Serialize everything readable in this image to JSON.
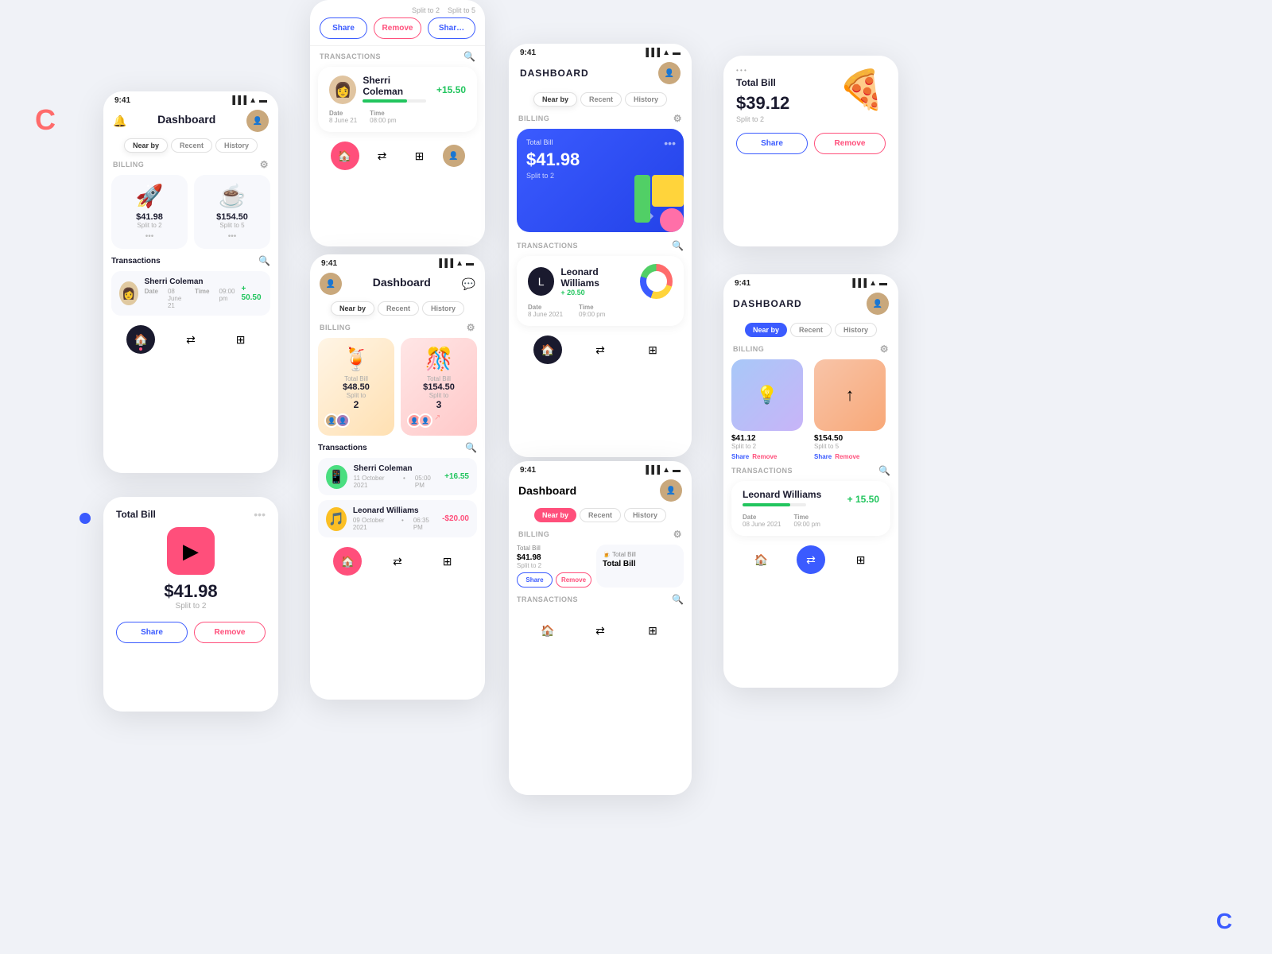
{
  "brand": {
    "logo": "C",
    "logo_color": "#ff6b6b"
  },
  "decorative": {
    "dot1_color": "#3b5bff",
    "dot2_color": "#3b5bff"
  },
  "phone1": {
    "time": "9:41",
    "title": "Dashboard",
    "tabs": [
      "Near by",
      "Recent",
      "History"
    ],
    "active_tab": "Near by",
    "billing_label": "Billing",
    "bills": [
      {
        "emoji": "🚀",
        "amount": "$41.98",
        "split": "Split to 2"
      },
      {
        "emoji": "☕",
        "amount": "$154.50",
        "split": "Split to 5"
      }
    ],
    "transactions_label": "Transactions",
    "txn_name": "Sherri Coleman",
    "txn_date_label": "Date",
    "txn_date": "08 June 21",
    "txn_time_label": "Time",
    "txn_time": "09:00 pm",
    "txn_amount": "+ 50.50"
  },
  "phone2": {
    "title": "Total Bill",
    "amount": "$41.98",
    "split": "Split to 2",
    "share_label": "Share",
    "remove_label": "Remove"
  },
  "phone3": {
    "transactions_label": "TRANSACTIONS",
    "sherri_name": "Sherri Coleman",
    "sherri_amount": "+15.50",
    "date_label": "Date",
    "date": "8 June 21",
    "time_label": "Time",
    "time": "08:00 pm"
  },
  "phone4": {
    "time": "9:41",
    "title": "Dashboard",
    "tabs": [
      "Near by",
      "Recent",
      "History"
    ],
    "active_tab": "Near by",
    "billing_label": "Billing",
    "bills": [
      {
        "emoji": "🍹",
        "amount": "$48.50",
        "split_to": "Split to",
        "split_num": "2"
      },
      {
        "emoji": "🎊",
        "amount": "$154.50",
        "split_to": "Split to",
        "split_num": "3"
      }
    ],
    "transactions_label": "Transactions",
    "txn1_name": "Sherri Coleman",
    "txn1_date": "11 October 2021",
    "txn1_time": "05:00 PM",
    "txn1_amount": "+16.55",
    "txn2_name": "Leonard Williams",
    "txn2_date": "09 October 2021",
    "txn2_time": "06:35 PM",
    "txn2_amount": "-$20.00"
  },
  "phone5": {
    "time": "9:41",
    "title": "DASHBOARD",
    "tabs": [
      "Near by",
      "Recent",
      "History"
    ],
    "active_tab": "Near by",
    "billing_label": "BILLING",
    "blue_card_title": "Total Bill",
    "blue_card_amount": "$41.98",
    "blue_card_split": "Split to 2",
    "transactions_label": "TRANSACTIONS",
    "txn_name": "Leonard Williams",
    "txn_amount": "+ 20.50",
    "txn_date_label": "Date",
    "txn_date": "8 June 2021",
    "txn_time_label": "Time",
    "txn_time": "09:00 pm"
  },
  "phone6": {
    "time": "9:41",
    "title": "Dashboard",
    "tabs": [
      "Near by",
      "Recent",
      "History"
    ],
    "active_tab": "Near by",
    "billing_label": "BILLING",
    "bill1_title": "Total Bill",
    "bill2_title": "Total Bill",
    "bill1_amount": "$41.98",
    "bill1_split": "Split to 2",
    "share_label": "Share",
    "remove_label": "Remove",
    "transactions_label": "TRANSACTIONS"
  },
  "phone7": {
    "title": "Total Bill",
    "amount": "$39.12",
    "split": "Split to 2",
    "share_label": "Share",
    "remove_label": "Remove"
  },
  "phone8": {
    "time": "9:41",
    "title": "DASHBOARD",
    "tabs": [
      "Near by",
      "Recent",
      "History"
    ],
    "active_tab": "Near by",
    "billing_label": "BILLING",
    "bill1_amount": "$41.12",
    "bill1_split": "Split to 2",
    "bill2_amount": "$154.50",
    "bill2_split": "Split to 5",
    "share_label": "Share",
    "remove_label": "Remove",
    "transactions_label": "TRANSACTIONS",
    "txn_name": "Leonard Williams",
    "txn_amount": "+ 15.50",
    "txn_date_label": "Date",
    "txn_date": "08 June 2021",
    "txn_time_label": "Time",
    "txn_time": "09:00 pm"
  }
}
